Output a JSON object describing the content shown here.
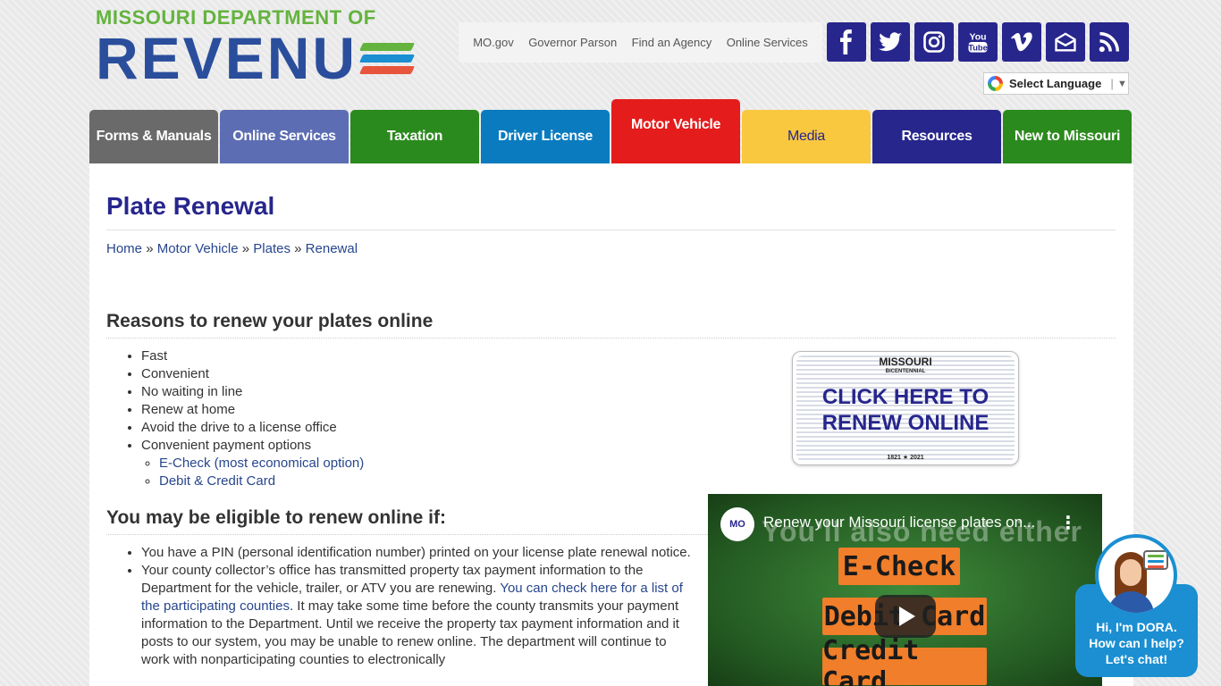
{
  "header": {
    "logo_top": "MISSOURI DEPARTMENT OF",
    "logo_main": "REVENU",
    "logo_stripe_colors": [
      "#64b33e",
      "#1b8fd2",
      "#e8553d"
    ],
    "util_links": [
      "MO.gov",
      "Governor Parson",
      "Find an Agency",
      "Online Services"
    ],
    "social_icons": [
      "facebook-icon",
      "twitter-icon",
      "instagram-icon",
      "youtube-icon",
      "vimeo-icon",
      "email-icon",
      "rss-icon"
    ],
    "youtube_label": [
      "You",
      "Tube"
    ],
    "language": "Select Language",
    "language_sep": "|",
    "language_arrow": "▼"
  },
  "nav": {
    "tabs": [
      {
        "label": "Forms & Manuals",
        "color": "#6a6a6a"
      },
      {
        "label": "Online Services",
        "color": "#5c6db3"
      },
      {
        "label": "Taxation",
        "color": "#2b8a1d"
      },
      {
        "label": "Driver License",
        "color": "#0a7bbf"
      },
      {
        "label": "Motor Vehicle",
        "color": "#e41c1c"
      },
      {
        "label": "Media",
        "color": "#f9c83f",
        "text_color": "#27268d"
      },
      {
        "label": "Resources",
        "color": "#27268d"
      },
      {
        "label": "New to Missouri",
        "color": "#2b8a1d"
      }
    ]
  },
  "page": {
    "title": "Plate Renewal",
    "breadcrumb": [
      "Home",
      "Motor Vehicle",
      "Plates",
      "Renewal"
    ],
    "breadcrumb_sep": "»",
    "section1": {
      "heading": "Reasons to renew your plates online",
      "items": [
        "Fast",
        "Convenient",
        "No waiting in line",
        "Renew at home",
        "Avoid the drive to a license office",
        "Convenient payment options"
      ],
      "sub_items": [
        "E-Check (most economical option)",
        "Debit & Credit Card"
      ]
    },
    "section2": {
      "heading": "You may be eligible to renew online if:",
      "item1": "You have a PIN (personal identification number) printed on your license plate renewal notice.",
      "item2_a": "Your county collector’s office has transmitted property tax payment information to the Department for the vehicle, trailer, or ATV you are renewing. ",
      "item2_link": "You can check here for a list of the participating counties",
      "item2_b": ". It may take some time before the county transmits your payment information to the Department. Until we receive the property tax payment information and it posts to our system, you may be unable to renew online. The department will continue to work with nonparticipating counties to electronically"
    },
    "plate": {
      "top": "MISSOURI",
      "top_small": "BICENTENNIAL",
      "text": "CLICK HERE TO RENEW ONLINE",
      "bottom": "1821 ★ 2021"
    },
    "video": {
      "badge": "MO",
      "title": "Renew your Missouri license plates on...",
      "menu": "⋮",
      "bg_text": "You'll also need either",
      "boxes": [
        "E-Check",
        "Debit Card",
        "Credit Card"
      ]
    }
  },
  "chat": {
    "line1": "Hi, I'm DORA.",
    "line2": "How can I help?",
    "line3": "Let's chat!"
  }
}
